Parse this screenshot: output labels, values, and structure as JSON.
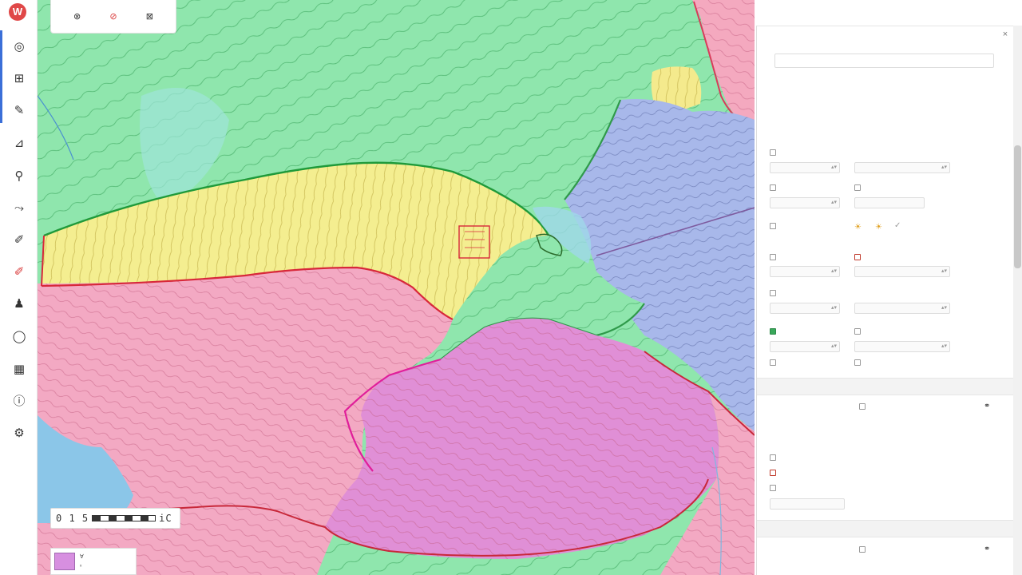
{
  "app": {
    "logo_text": "W",
    "colors": {
      "accent": "#3b6fd8",
      "logo": "#e04848",
      "warn": "#c0392b"
    }
  },
  "left_toolbar": {
    "tools": [
      {
        "icon": "globe-icon",
        "glyph": "◎"
      },
      {
        "icon": "layers-icon",
        "glyph": "⊞"
      },
      {
        "icon": "draw-icon",
        "glyph": "✎"
      },
      {
        "icon": "measure-icon",
        "glyph": "⊿"
      },
      {
        "icon": "pin-icon",
        "glyph": "⚲"
      },
      {
        "icon": "route-icon",
        "glyph": "⤳"
      },
      {
        "icon": "pencil-icon",
        "glyph": "✐"
      },
      {
        "icon": "marker-icon",
        "glyph": "✐"
      },
      {
        "icon": "person-icon",
        "glyph": "♟"
      },
      {
        "icon": "circle-icon",
        "glyph": "◯"
      },
      {
        "icon": "grid-icon",
        "glyph": "▦"
      },
      {
        "icon": "info-icon",
        "glyph": "ⓘ"
      },
      {
        "icon": "settings-icon",
        "glyph": "⚙"
      }
    ]
  },
  "mini_toolbar": {
    "buttons": [
      {
        "glyph": "⊗",
        "label": "▪"
      },
      {
        "glyph": "⊘",
        "label": "▪"
      },
      {
        "glyph": "⊠",
        "label": "▪"
      }
    ]
  },
  "map": {
    "scale_text": "0 1 5 ",
    "scale_suffix": "iC",
    "legend_line1": "Ɐ",
    "legend_line2": "ₓ"
  },
  "panel": {
    "title": "",
    "search_placeholder": "",
    "subtitle": "",
    "warning": "",
    "warning_sub": "",
    "col_left": "",
    "col_right": "",
    "rows": [],
    "sections": []
  }
}
